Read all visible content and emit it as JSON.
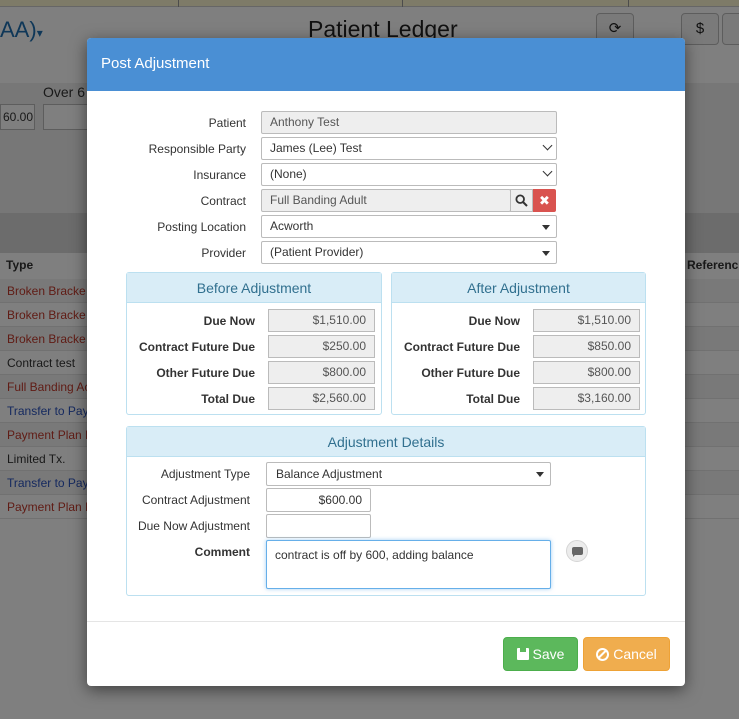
{
  "background": {
    "patient_name_fragment": "AA)",
    "title": "Patient Ledger",
    "refresh_glyph": "⟳",
    "dollar_label": "$",
    "over_label": "Over 6",
    "amount_fragment": "60.00",
    "col_type": "Type",
    "col_reference": "Referenc",
    "rows": [
      {
        "text": "Broken Bracke",
        "color": "red"
      },
      {
        "text": "Broken Bracke",
        "color": "red"
      },
      {
        "text": "Broken Bracke",
        "color": "red"
      },
      {
        "text": "Contract test",
        "color": "dark"
      },
      {
        "text": "Full Banding Ac",
        "color": "red"
      },
      {
        "text": "Transfer to Pay",
        "color": "blue"
      },
      {
        "text": "Payment Plan I",
        "color": "red"
      },
      {
        "text": "Limited Tx.",
        "color": "dark"
      },
      {
        "text": "Transfer to Pay",
        "color": "blue"
      },
      {
        "text": "Payment Plan I",
        "color": "red"
      }
    ]
  },
  "modal": {
    "title": "Post Adjustment",
    "form": {
      "patient_label": "Patient",
      "patient_value": "Anthony Test",
      "responsible_label": "Responsible Party",
      "responsible_value": "James (Lee) Test",
      "insurance_label": "Insurance",
      "insurance_value": "(None)",
      "contract_label": "Contract",
      "contract_value": "Full Banding Adult",
      "location_label": "Posting Location",
      "location_value": "Acworth",
      "provider_label": "Provider",
      "provider_value": "(Patient Provider)"
    },
    "before": {
      "title": "Before Adjustment",
      "due_now_label": "Due Now",
      "due_now": "$1,510.00",
      "contract_future_label": "Contract Future Due",
      "contract_future": "$250.00",
      "other_future_label": "Other Future Due",
      "other_future": "$800.00",
      "total_label": "Total Due",
      "total": "$2,560.00"
    },
    "after": {
      "title": "After Adjustment",
      "due_now_label": "Due Now",
      "due_now": "$1,510.00",
      "contract_future_label": "Contract Future Due",
      "contract_future": "$850.00",
      "other_future_label": "Other Future Due",
      "other_future": "$800.00",
      "total_label": "Total Due",
      "total": "$3,160.00"
    },
    "details": {
      "title": "Adjustment Details",
      "type_label": "Adjustment Type",
      "type_value": "Balance Adjustment",
      "contract_adj_label": "Contract Adjustment",
      "contract_adj_value": "$600.00",
      "due_now_adj_label": "Due Now Adjustment",
      "due_now_adj_value": "",
      "comment_label": "Comment",
      "comment_value": "contract is off by 600, adding balance"
    },
    "footer": {
      "save_label": "Save",
      "cancel_label": "Cancel"
    }
  },
  "colors": {
    "header_blue": "#4a8fd4",
    "panel_head": "#d9edf7",
    "save_green": "#5cb85c",
    "cancel_orange": "#f0ad4e",
    "clear_red": "#d9534f"
  }
}
